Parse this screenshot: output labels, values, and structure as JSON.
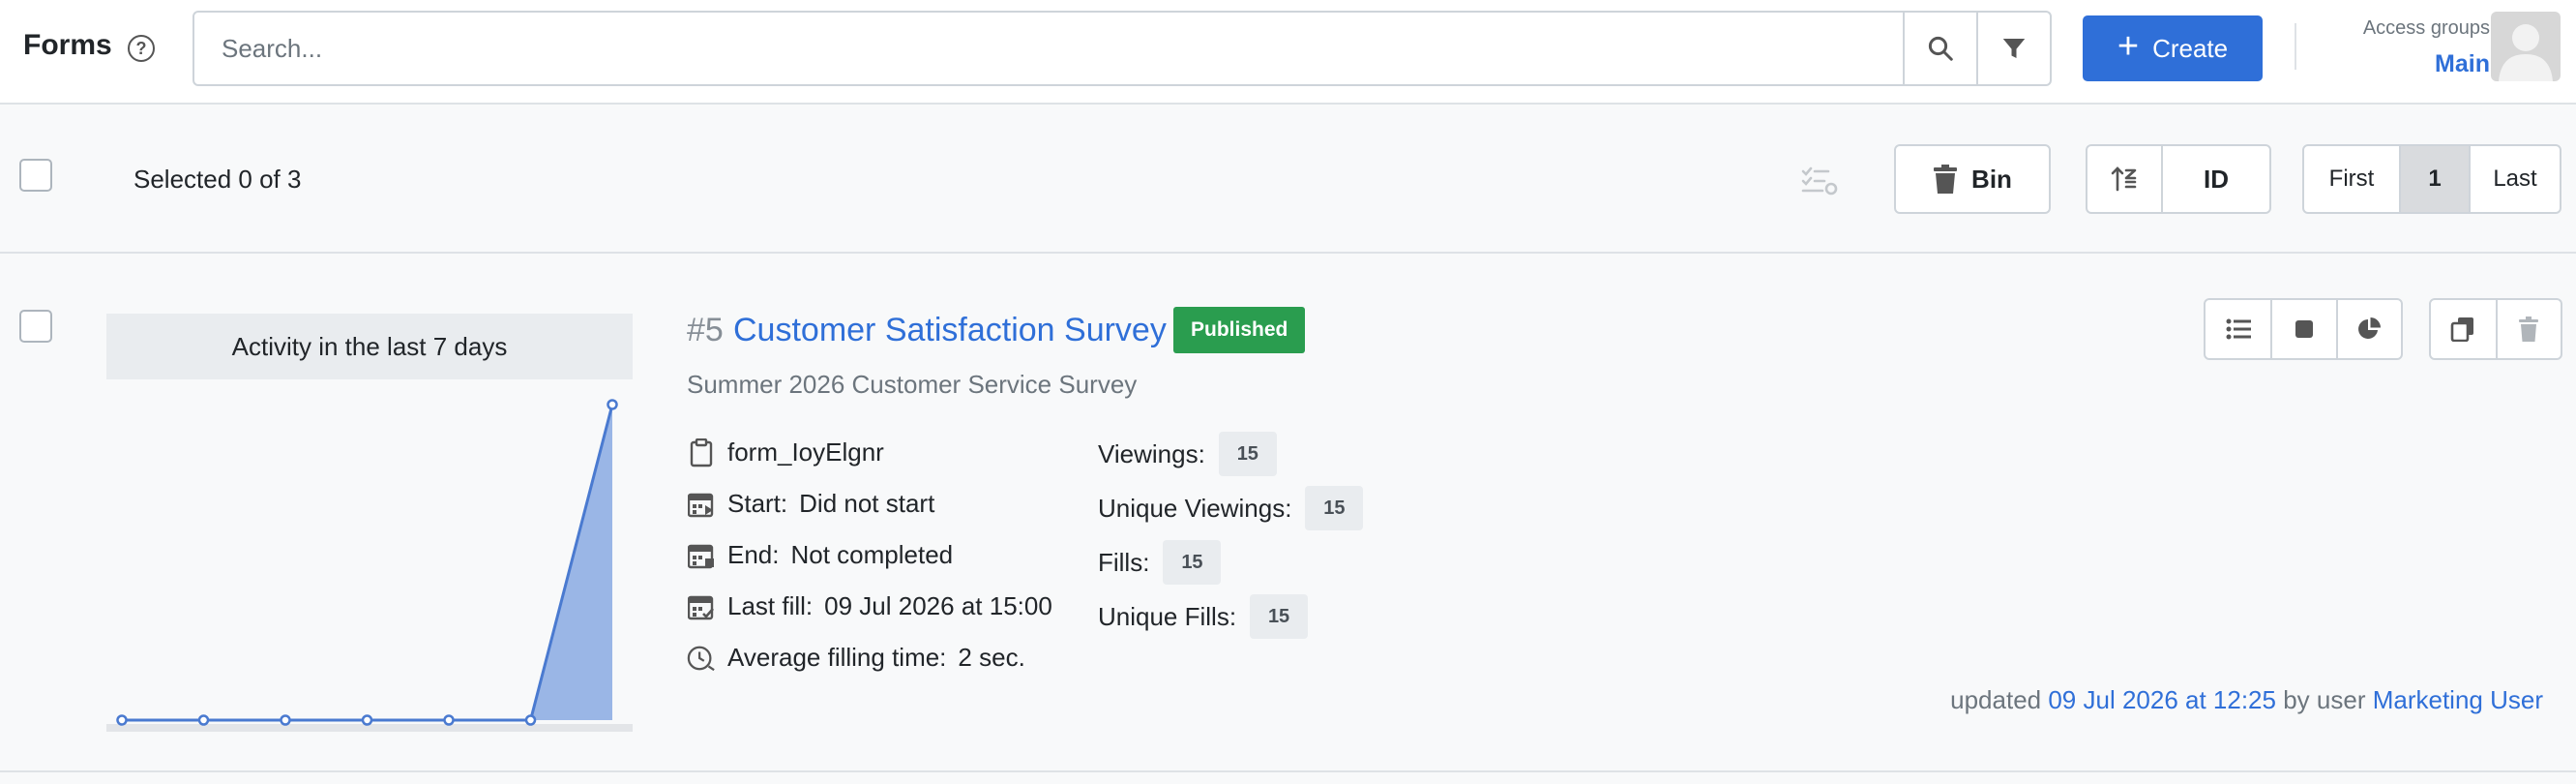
{
  "header": {
    "title": "Forms",
    "help_icon": "question-circle-icon",
    "search_placeholder": "Search...",
    "create_label": "Create",
    "access_groups_label": "Access groups",
    "access_groups_value": "Main"
  },
  "toolbar": {
    "selected_text": "Selected 0 of 3",
    "bin_label": "Bin",
    "sort_field": "ID",
    "pager": {
      "first": "First",
      "current": "1",
      "last": "Last"
    }
  },
  "form": {
    "activity_title": "Activity in the last 7 days",
    "activity": [
      0,
      0,
      0,
      0,
      0,
      0,
      15
    ],
    "number": "#5",
    "title": "Customer Satisfaction Survey",
    "status": "Published",
    "subtitle": "Summer 2026 Customer Service Survey",
    "code": "form_IoyElgnr",
    "start_label": "Start:",
    "start_value": "Did not start",
    "end_label": "End:",
    "end_value": "Not completed",
    "last_fill_label": "Last fill:",
    "last_fill_value": "09 Jul 2026 at 15:00",
    "avg_label": "Average filling time:",
    "avg_value": "2 sec.",
    "stats": {
      "viewings_label": "Viewings:",
      "viewings": "15",
      "unique_viewings_label": "Unique Viewings:",
      "unique_viewings": "15",
      "fills_label": "Fills:",
      "fills": "15",
      "unique_fills_label": "Unique Fills:",
      "unique_fills": "15"
    },
    "updated_prefix": "updated",
    "updated_date": "09 Jul 2026 at 12:25",
    "updated_by": "by user",
    "updated_user": "Marketing User"
  },
  "colors": {
    "primary": "#2f6fd8",
    "published": "#2a9d4f",
    "chart_fill": "#9ab6e6",
    "chart_line": "#4a7ad0"
  }
}
